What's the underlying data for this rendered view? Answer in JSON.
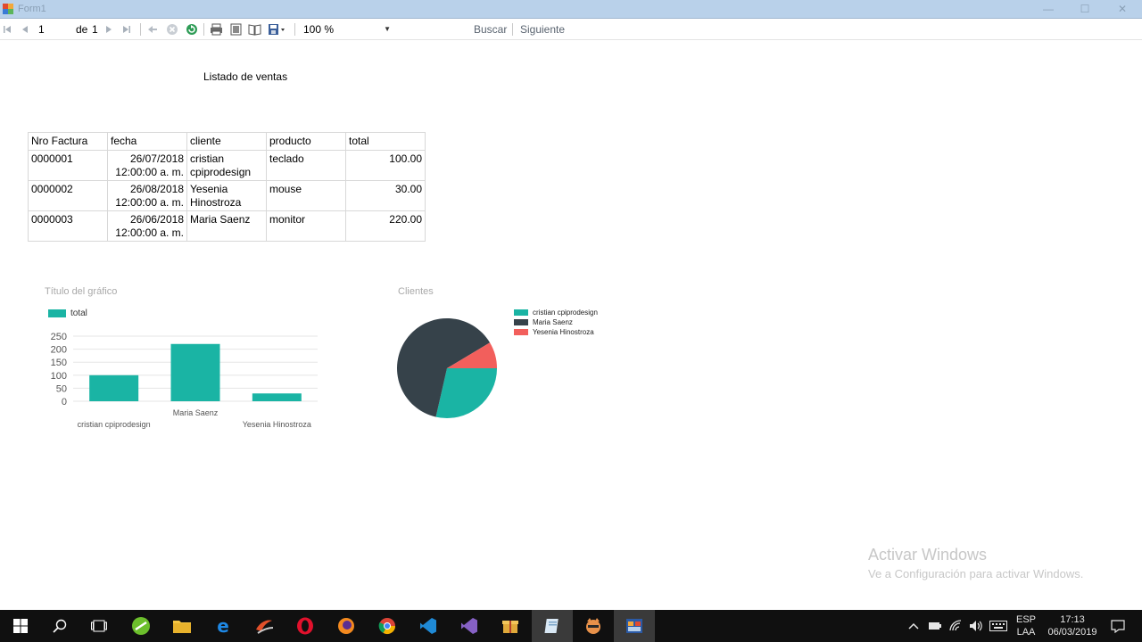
{
  "window": {
    "title": "Form1"
  },
  "toolbar": {
    "page_current": "1",
    "page_of_label": "de",
    "page_total": "1",
    "zoom_value": "100 %",
    "find_label": "Buscar",
    "next_label": "Siguiente"
  },
  "report": {
    "title": "Listado de ventas",
    "columns": [
      "Nro Factura",
      "fecha",
      "cliente",
      "producto",
      "total"
    ],
    "rows": [
      {
        "factura": "0000001",
        "fecha1": "26/07/2018",
        "fecha2": "12:00:00 a. m.",
        "cliente1": "cristian",
        "cliente2": "cpiprodesign",
        "producto": "teclado",
        "total": "100.00"
      },
      {
        "factura": "0000002",
        "fecha1": "26/08/2018",
        "fecha2": "12:00:00 a. m.",
        "cliente1": "Yesenia",
        "cliente2": "Hinostroza",
        "producto": "mouse",
        "total": "30.00"
      },
      {
        "factura": "0000003",
        "fecha1": "26/06/2018",
        "fecha2": "12:00:00 a. m.",
        "cliente1": "Maria Saenz",
        "cliente2": "",
        "producto": "monitor",
        "total": "220.00"
      }
    ]
  },
  "chart_data": [
    {
      "type": "bar",
      "title": "Título del gráfico",
      "categories": [
        "cristian cpiprodesign",
        "Maria Saenz",
        "Yesenia Hinostroza"
      ],
      "series": [
        {
          "name": "total",
          "values": [
            100,
            220,
            30
          ],
          "color": "#1ab4a4"
        }
      ],
      "ylim": [
        0,
        250
      ],
      "yticks": [
        "0",
        "50",
        "100",
        "150",
        "200",
        "250"
      ],
      "grid": true,
      "legend": "top-left"
    },
    {
      "type": "pie",
      "title": "Clientes",
      "labels": [
        "cristian cpiprodesign",
        "Maria Saenz",
        "Yesenia Hinostroza"
      ],
      "values": [
        100,
        220,
        30
      ],
      "colors": [
        "#1ab4a4",
        "#36424a",
        "#f25f5c"
      ],
      "legend": "right"
    }
  ],
  "watermark": {
    "line1": "Activar Windows",
    "line2": "Ve a Configuración para activar Windows."
  },
  "taskbar": {
    "lang_top": "ESP",
    "lang_bottom": "LAA",
    "time": "17:13",
    "date": "06/03/2019"
  }
}
